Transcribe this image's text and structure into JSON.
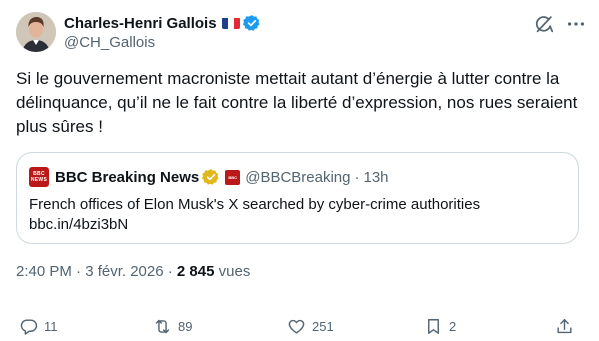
{
  "author": {
    "display_name": "Charles-Henri Gallois",
    "handle": "@CH_Gallois",
    "flag": "french-flag",
    "verified": true
  },
  "tweet": {
    "text": "Si le gouvernement macroniste mettait autant d’énergie à lutter contre la délinquance, qu’il ne le fait contre la liberté d’expression, nos rues seraient plus sûres !"
  },
  "quoted": {
    "avatar_text_top": "BBC",
    "avatar_text_bottom": "NEWS",
    "display_name": "BBC Breaking News",
    "badge": "gold-verified-badge",
    "affiliate_logo_text": "BBC",
    "handle": "@BBCBreaking",
    "separator": "·",
    "time": "13h",
    "text_line1": "French offices of Elon Musk's X searched by cyber-crime authorities",
    "text_line2": "bbc.in/4bzi3bN"
  },
  "meta": {
    "time_date": "2:40 PM · 3 févr. 2026 · ",
    "views_count": "2 845",
    "views_label": " vues"
  },
  "actions": {
    "replies": "11",
    "reposts": "89",
    "likes": "251",
    "bookmarks": "2"
  },
  "colors": {
    "text_primary": "#0f1419",
    "text_secondary": "#536471",
    "verified_blue": "#1d9bf0",
    "verified_gold": "#e2b719",
    "bbc_red": "#bb1919",
    "border": "#cfd9de"
  }
}
